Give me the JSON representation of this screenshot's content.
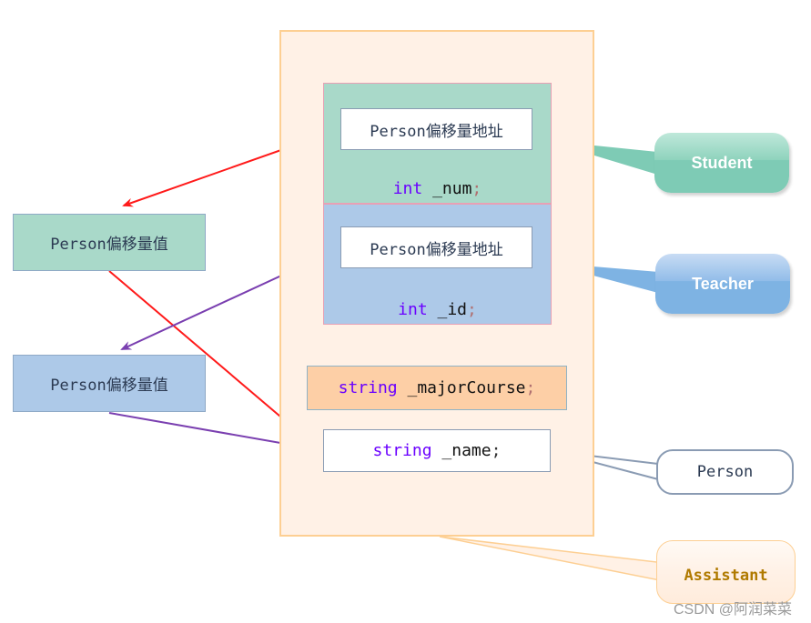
{
  "container": {
    "class_name": "Assistant",
    "student_part": {
      "vbptr_label": "Person偏移量地址",
      "member_type": "int",
      "member_name": " _num",
      "member_semi": ";"
    },
    "teacher_part": {
      "vbptr_label": "Person偏移量地址",
      "member_type": "int",
      "member_name": " _id",
      "member_semi": ";"
    },
    "assistant_member": {
      "type": "string",
      "name": " _majorCourse",
      "semi": ";"
    },
    "person_member": {
      "type": "string",
      "name": " _name",
      "semi": ";"
    }
  },
  "offset_tables": [
    {
      "label": "Person偏移量值",
      "color": "#a9d9c9"
    },
    {
      "label": "Person偏移量值",
      "color": "#adc9e8"
    }
  ],
  "callouts": {
    "student": "Student",
    "teacher": "Teacher",
    "person": "Person",
    "assistant": "Assistant"
  },
  "colors": {
    "student": "#7ecbb5",
    "teacher": "#7eb3e3",
    "person_border": "#8a9bb3",
    "assistant_fill": "#fff1e6",
    "assistant_border": "#fdcf93",
    "assistant_text": "#b07a00",
    "arrow_red": "#ff1a1a",
    "arrow_purple": "#7a3fb0",
    "keyword": "#6a00ff"
  },
  "watermark": "CSDN @阿润菜菜"
}
